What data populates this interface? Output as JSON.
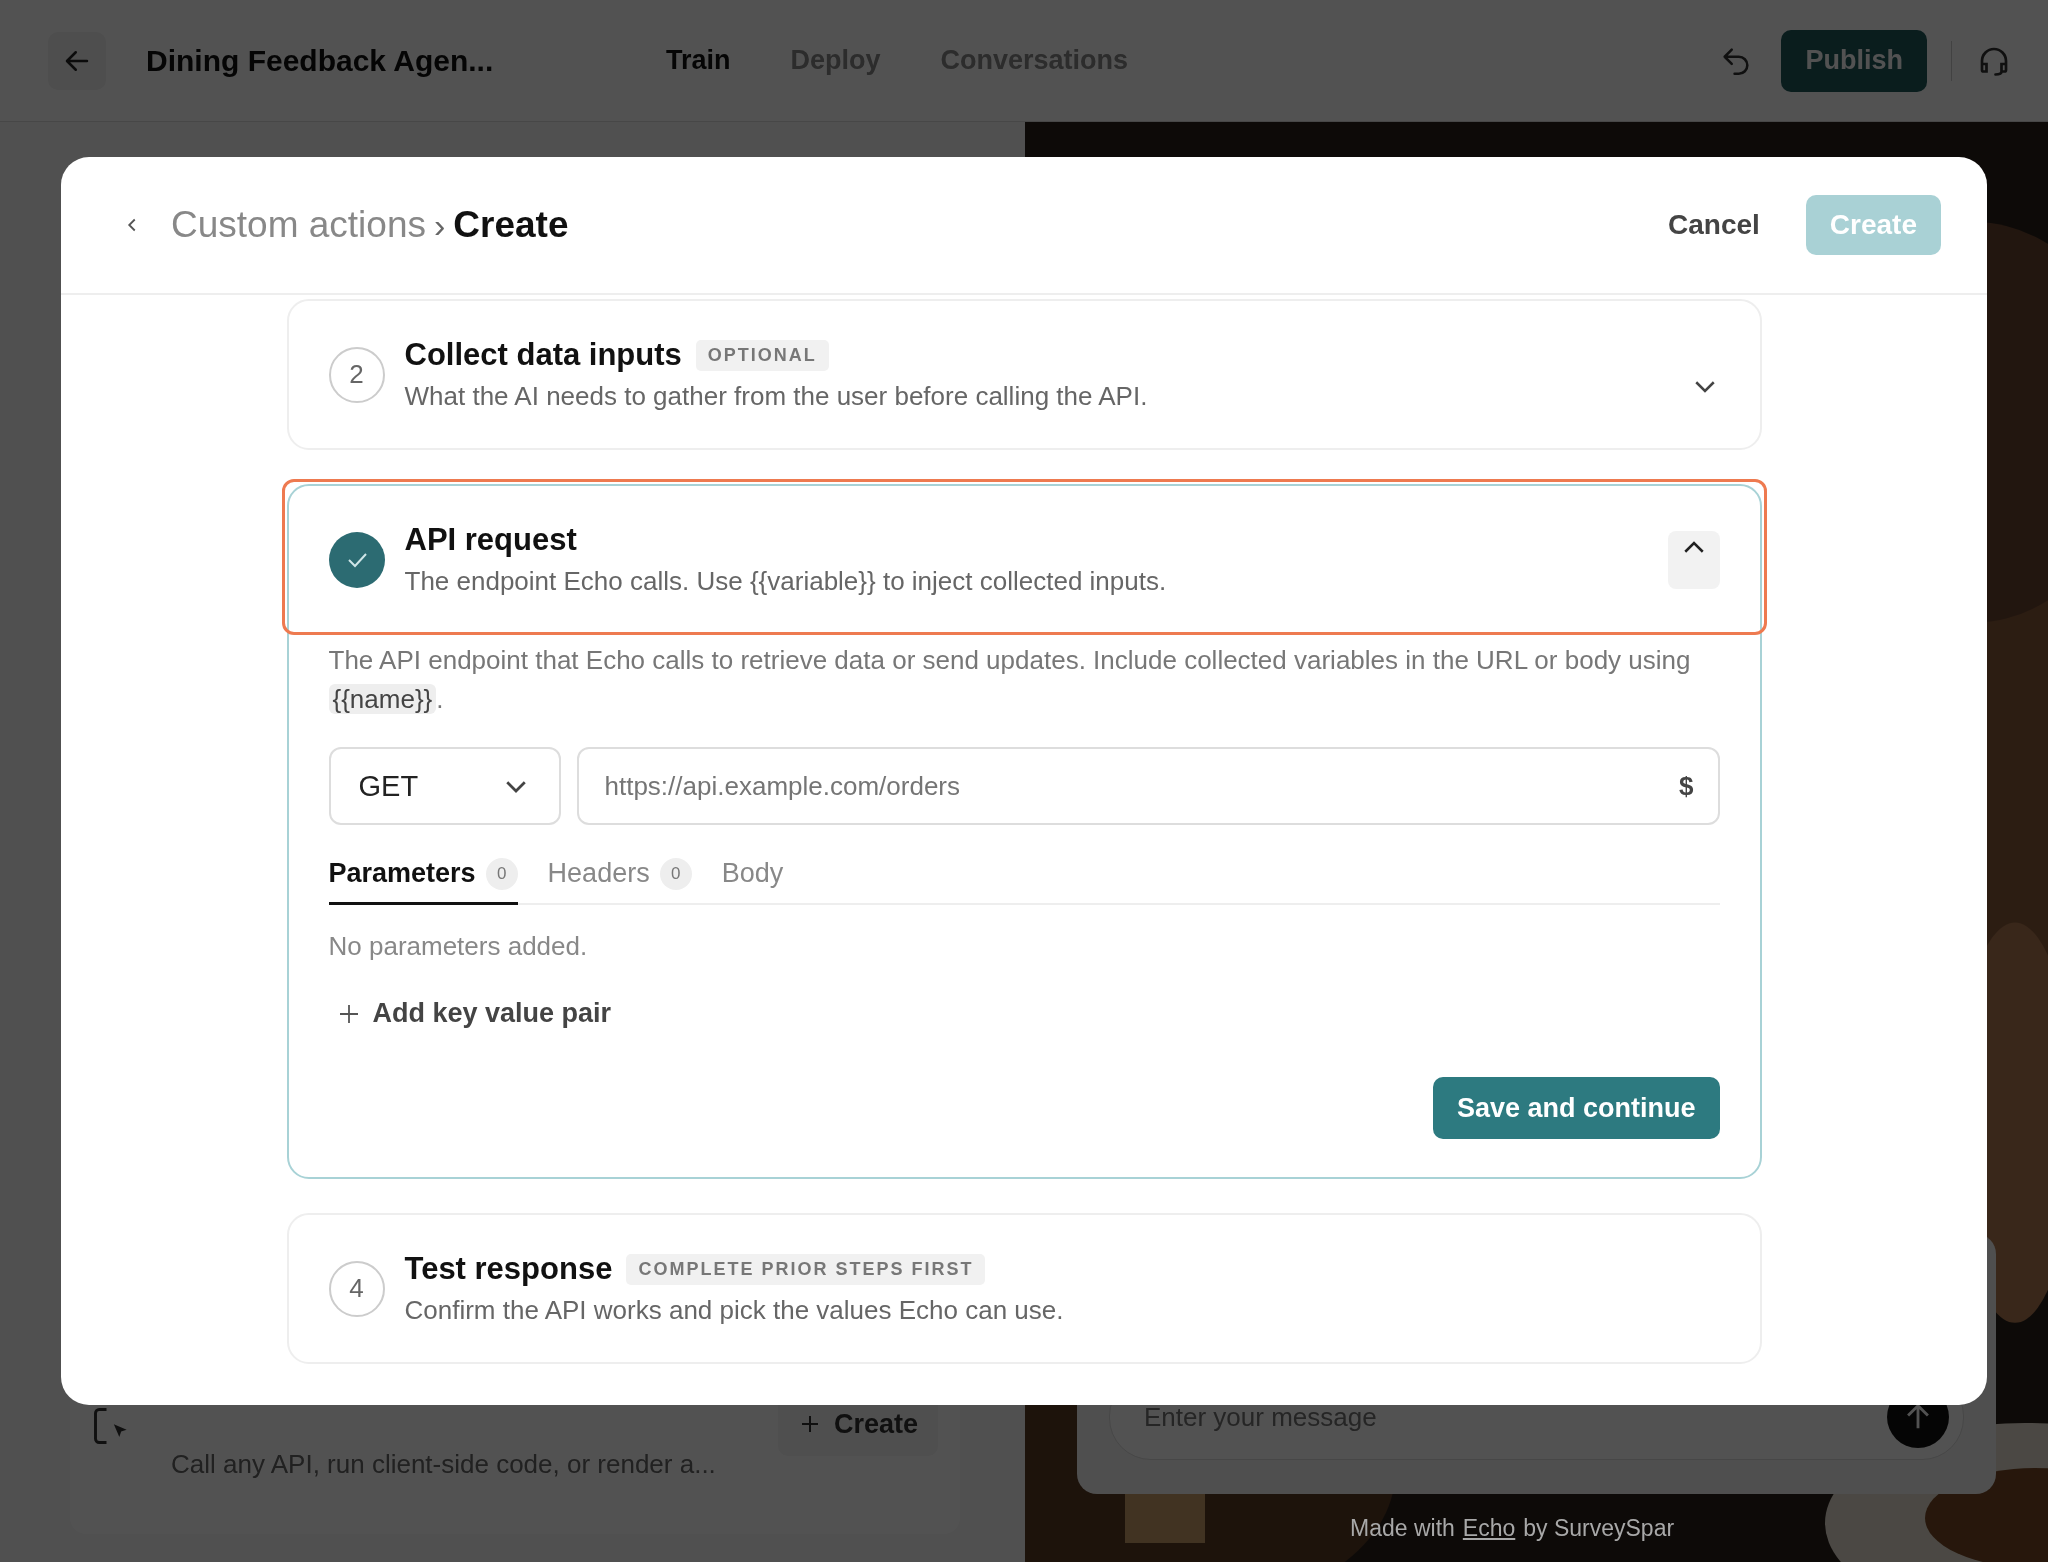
{
  "top_bar": {
    "title": "Dining Feedback Agen...",
    "tabs": [
      {
        "label": "Train",
        "selected": true
      },
      {
        "label": "Deploy",
        "selected": false
      },
      {
        "label": "Conversations",
        "selected": false
      }
    ],
    "publish_button": "Publish"
  },
  "background": {
    "action_card": {
      "description": "Call any API, run client-side code, or render a...",
      "create_button": "Create"
    },
    "chat": {
      "placeholder": "Enter your message"
    },
    "footer": {
      "prefix": "Made with",
      "link": "Echo",
      "suffix": "by SurveySpar"
    }
  },
  "modal": {
    "breadcrumb": {
      "parent": "Custom actions",
      "separator": "›",
      "current": "Create"
    },
    "cancel_button": "Cancel",
    "create_button": {
      "label": "Create",
      "disabled": true
    },
    "steps": [
      {
        "kind": "collapsed",
        "number": "2",
        "completed": false,
        "expanded": false,
        "highlighted": false,
        "title": "Collect data inputs",
        "badge": "OPTIONAL",
        "description": "What the AI needs to gather from the user before calling the API."
      },
      {
        "kind": "request",
        "completed": true,
        "expanded": true,
        "highlighted": true,
        "title": "API request",
        "description": "The endpoint Echo calls. Use {{variable}} to inject collected inputs.",
        "intro_before": "The API endpoint that Echo calls to retrieve data or send updates. Include collected variables in the URL or body using",
        "intro_code": "{{name}}",
        "intro_after": ".",
        "method": "GET",
        "url": {
          "placeholder": "https://api.example.com/orders",
          "suffix": "$"
        },
        "tabs": [
          {
            "label": "Parameters",
            "count": "0",
            "selected": true
          },
          {
            "label": "Headers",
            "count": "0",
            "selected": false
          },
          {
            "label": "Body",
            "selected": false
          }
        ],
        "empty_text": "No parameters added.",
        "add_button": "Add key value pair",
        "save_button": "Save and continue"
      },
      {
        "kind": "locked",
        "number": "4",
        "completed": false,
        "expanded": false,
        "highlighted": false,
        "title": "Test response",
        "badge": "COMPLETE PRIOR STEPS FIRST",
        "description": "Confirm the API works and pick the values Echo can use."
      }
    ]
  }
}
